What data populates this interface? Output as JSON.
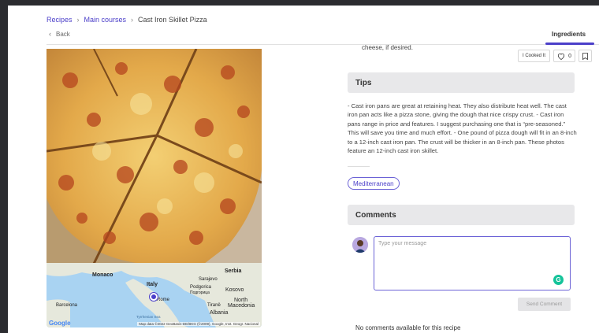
{
  "breadcrumb": {
    "items": [
      "Recipes",
      "Main courses"
    ],
    "current": "Cast Iron Skillet Pizza"
  },
  "back_label": "Back",
  "tabs": {
    "ingredients": "Ingredients"
  },
  "actions": {
    "cooked_label": "I Cooked It",
    "like_count": "0"
  },
  "ingredient_tail": "cheese, if desired.",
  "tips": {
    "title": "Tips",
    "body": "- Cast iron pans are great at retaining heat. They also distribute heat well. The cast iron pan acts like a pizza stone, giving the dough that nice crispy crust. - Cast iron pans range in price and features. I suggest purchasing one that is “pre-seasoned.” This will save you time and much effort. - One pound of pizza dough will fit in an 8-inch to a 12-inch cast iron pan. The crust will be thicker in an 8-inch pan. These photos feature an 12-inch cast iron skillet."
  },
  "cuisine_tag": "Mediterranean",
  "comments": {
    "title": "Comments",
    "placeholder": "Type your message",
    "send_label": "Send Comment",
    "empty_text": "No comments available for this recipe"
  },
  "map": {
    "labels": {
      "monaco": "Monaco",
      "serbia": "Serbia",
      "sarajevo": "Sarajevo",
      "podgorica": "Podgorica",
      "podgorica_cyr": "Подгорица",
      "italy": "Italy",
      "kosovo": "Kosovo",
      "rome": "Rome",
      "north": "North",
      "macedonia": "Macedonia",
      "barcelona": "Barcelona",
      "tirane": "Tiranë",
      "albania": "Albania",
      "tyrrhenian": "Tyrrhenian Sea"
    },
    "google": "Google",
    "attribution": "Map data ©2022 GeoBasis-DE/BKG (©2009), Google, Inst. Geogr. Nacional"
  },
  "colors": {
    "accent": "#4b3fc9",
    "header_bg": "#e8e8ea",
    "grammarly": "#15c39a"
  }
}
